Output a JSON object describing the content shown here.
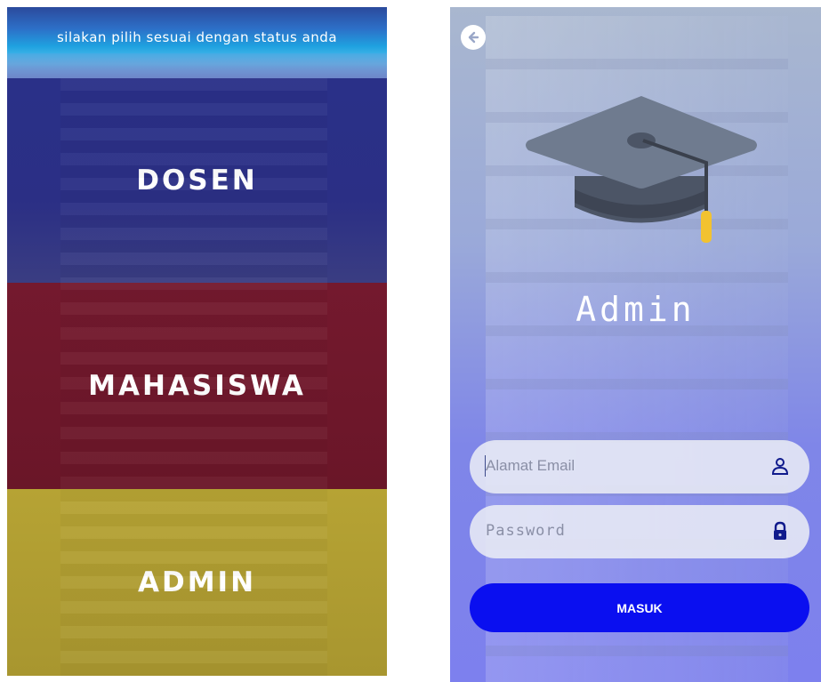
{
  "left": {
    "banner_text": "silakan pilih sesuai dengan status anda",
    "roles": {
      "dosen": "DOSEN",
      "mahasiswa": "MAHASISWA",
      "admin": "ADMIN"
    }
  },
  "right": {
    "title": "Admin",
    "email_placeholder": "Alamat Email",
    "password_placeholder": "Password",
    "submit_label": "MASUK"
  },
  "colors": {
    "dosen": "#2b2f85",
    "mahasiswa": "#6a1628",
    "admin": "#a8962f",
    "button": "#0a0ff0"
  }
}
